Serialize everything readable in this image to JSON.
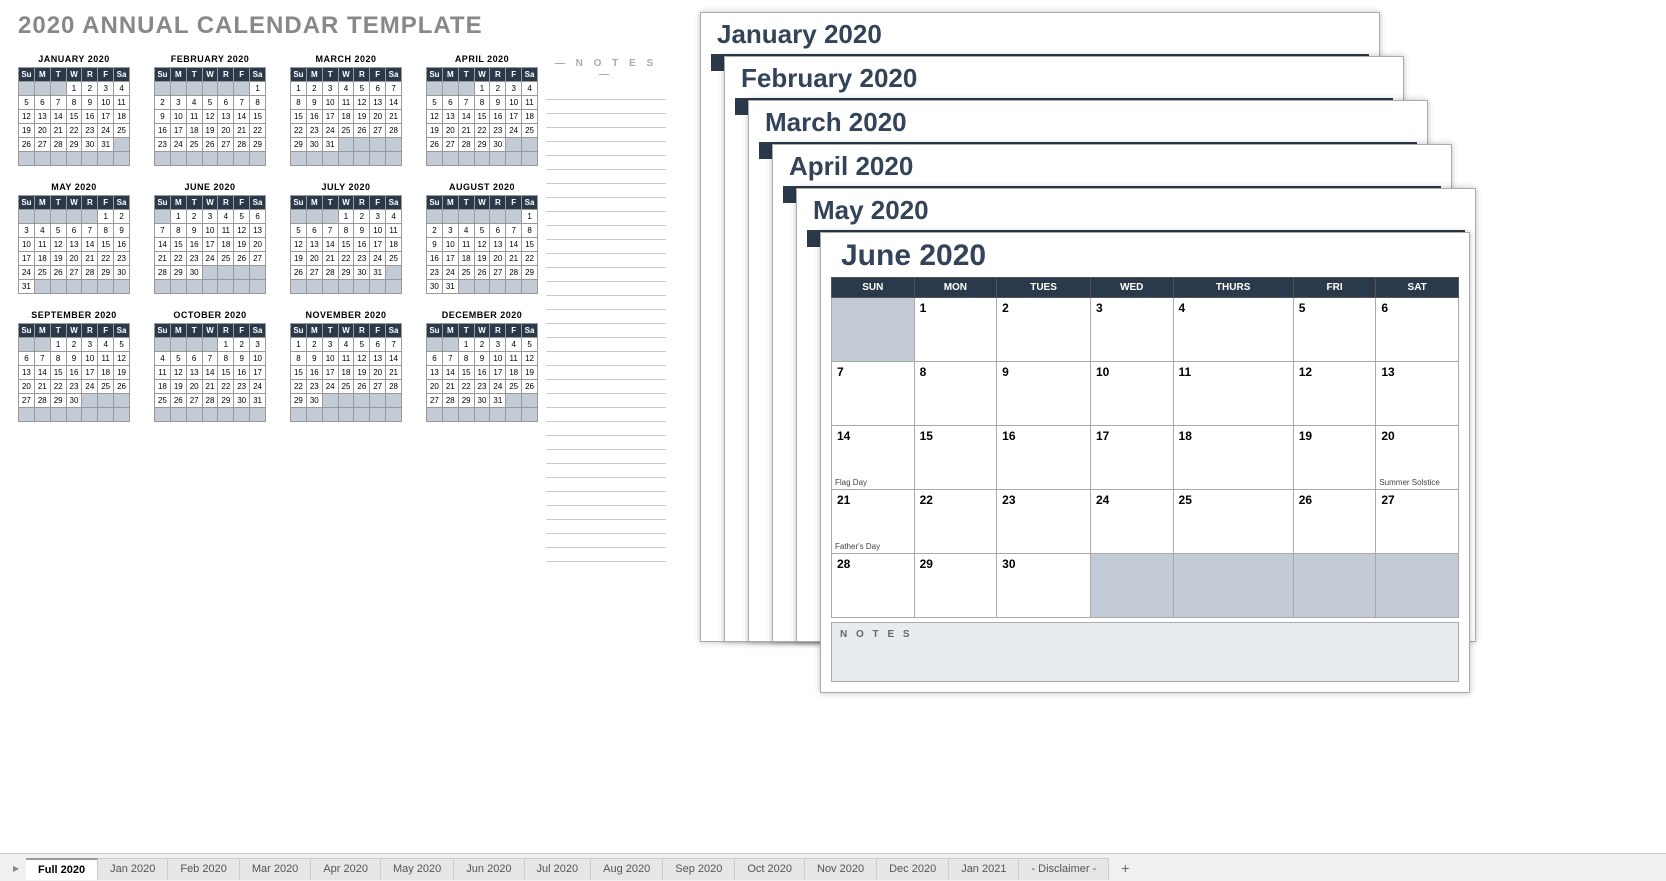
{
  "annual": {
    "title": "2020 ANNUAL CALENDAR TEMPLATE",
    "notes_label": "— N O T E S —",
    "day_abbr": [
      "Su",
      "M",
      "T",
      "W",
      "R",
      "F",
      "Sa"
    ],
    "months": [
      {
        "name": "JANUARY 2020",
        "start": 3,
        "days": 31
      },
      {
        "name": "FEBRUARY 2020",
        "start": 6,
        "days": 29
      },
      {
        "name": "MARCH 2020",
        "start": 0,
        "days": 31
      },
      {
        "name": "APRIL 2020",
        "start": 3,
        "days": 30
      },
      {
        "name": "MAY 2020",
        "start": 5,
        "days": 31
      },
      {
        "name": "JUNE 2020",
        "start": 1,
        "days": 30
      },
      {
        "name": "JULY 2020",
        "start": 3,
        "days": 31
      },
      {
        "name": "AUGUST 2020",
        "start": 6,
        "days": 31
      },
      {
        "name": "SEPTEMBER 2020",
        "start": 2,
        "days": 30
      },
      {
        "name": "OCTOBER 2020",
        "start": 4,
        "days": 31
      },
      {
        "name": "NOVEMBER 2020",
        "start": 0,
        "days": 30
      },
      {
        "name": "DECEMBER 2020",
        "start": 2,
        "days": 31
      }
    ]
  },
  "stack_days": [
    "SUN",
    "MON",
    "TUES",
    "WED",
    "THURS",
    "FRI",
    "SAT"
  ],
  "stack_titles": [
    "January 2020",
    "February 2020",
    "March 2020",
    "April 2020",
    "May 2020",
    "June 2020"
  ],
  "big_month": {
    "title": "June 2020",
    "days": [
      "SUN",
      "MON",
      "TUES",
      "WED",
      "THURS",
      "FRI",
      "SAT"
    ],
    "start": 1,
    "ndays": 30,
    "events": {
      "14": "Flag Day",
      "20": "Summer Solstice",
      "21": "Father's Day"
    },
    "notes_label": "N O T E S"
  },
  "tabs": [
    "Full 2020",
    "Jan 2020",
    "Feb 2020",
    "Mar 2020",
    "Apr 2020",
    "May 2020",
    "Jun 2020",
    "Jul 2020",
    "Aug 2020",
    "Sep 2020",
    "Oct 2020",
    "Nov 2020",
    "Dec 2020",
    "Jan 2021",
    "- Disclaimer -"
  ],
  "active_tab": 0,
  "plus": "+"
}
